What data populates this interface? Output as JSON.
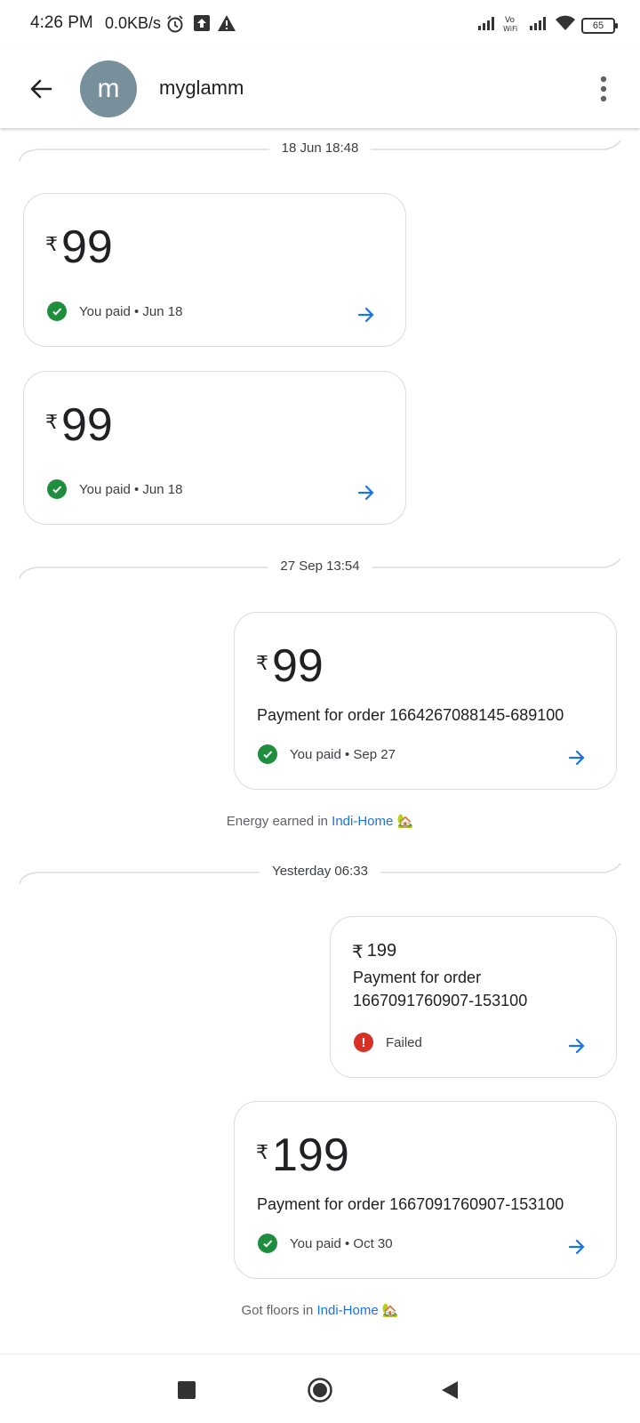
{
  "status_bar": {
    "time": "4:26 PM",
    "speed": "0.0KB/s",
    "battery": "65",
    "icons": [
      "alarm-icon",
      "upload-icon",
      "warning-icon",
      "signal-icon",
      "vowifi-icon",
      "signal-icon",
      "wifi-icon",
      "battery-icon"
    ]
  },
  "header": {
    "avatar_letter": "m",
    "contact_name": "myglamm"
  },
  "colors": {
    "accent": "#1a73e8",
    "success": "#1e8e3e",
    "error": "#d93025",
    "avatar": "#78909c"
  },
  "separators": [
    {
      "label": "18 Jun 18:48"
    },
    {
      "label": "27 Sep 13:54"
    },
    {
      "label": "Yesterday 06:33"
    }
  ],
  "payments": [
    {
      "currency": "₹",
      "amount": "99",
      "description": "",
      "status": "You paid • Jun 18",
      "state": "success"
    },
    {
      "currency": "₹",
      "amount": "99",
      "description": "",
      "status": "You paid • Jun 18",
      "state": "success"
    },
    {
      "currency": "₹",
      "amount": "99",
      "description": "Payment for order 1664267088145-689100",
      "status": "You paid • Sep 27",
      "state": "success"
    },
    {
      "currency": "₹",
      "amount": "199",
      "description": "Payment for order 1667091760907-153100",
      "status": "Failed",
      "state": "failed"
    },
    {
      "currency": "₹",
      "amount": "199",
      "description": "Payment for order 1667091760907-153100",
      "status": "You paid • Oct 30",
      "state": "success"
    }
  ],
  "notes": [
    {
      "prefix": "Energy earned in ",
      "link": "Indi-Home",
      "emoji": "🏡"
    },
    {
      "prefix": "Got floors in ",
      "link": "Indi-Home",
      "emoji": "🏡"
    }
  ]
}
